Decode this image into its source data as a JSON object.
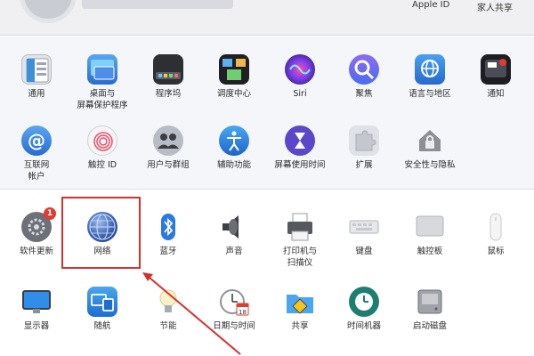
{
  "header": {
    "apple_id": "Apple ID",
    "family_sharing": "家人共享"
  },
  "colors": {
    "highlight": "#d3312c",
    "badge": "#e23b33"
  },
  "top_row1": [
    {
      "label": "通用",
      "icon": "general-icon"
    },
    {
      "label": "桌面与\n屏幕保护程序",
      "icon": "desktop-icon"
    },
    {
      "label": "程序坞",
      "icon": "dock-icon"
    },
    {
      "label": "调度中心",
      "icon": "mission-control-icon"
    },
    {
      "label": "Siri",
      "icon": "siri-icon"
    },
    {
      "label": "聚焦",
      "icon": "spotlight-icon"
    },
    {
      "label": "语言与地区",
      "icon": "language-icon"
    },
    {
      "label": "通知",
      "icon": "notifications-icon"
    }
  ],
  "top_row2": [
    {
      "label": "互联网\n帐户",
      "icon": "internet-accounts-icon"
    },
    {
      "label": "触控 ID",
      "icon": "touch-id-icon"
    },
    {
      "label": "用户与群组",
      "icon": "users-icon"
    },
    {
      "label": "辅助功能",
      "icon": "accessibility-icon"
    },
    {
      "label": "屏幕使用时间",
      "icon": "screen-time-icon"
    },
    {
      "label": "扩展",
      "icon": "extensions-icon"
    },
    {
      "label": "安全性与隐私",
      "icon": "security-icon"
    }
  ],
  "bottom_row1": [
    {
      "label": "软件更新",
      "icon": "software-update-icon",
      "badge": "1"
    },
    {
      "label": "网络",
      "icon": "network-icon"
    },
    {
      "label": "蓝牙",
      "icon": "bluetooth-icon"
    },
    {
      "label": "声音",
      "icon": "sound-icon"
    },
    {
      "label": "打印机与\n扫描仪",
      "icon": "printer-icon"
    },
    {
      "label": "键盘",
      "icon": "keyboard-icon"
    },
    {
      "label": "触控板",
      "icon": "trackpad-icon"
    },
    {
      "label": "鼠标",
      "icon": "mouse-icon"
    }
  ],
  "bottom_row2": [
    {
      "label": "显示器",
      "icon": "displays-icon"
    },
    {
      "label": "随航",
      "icon": "sidecar-icon"
    },
    {
      "label": "节能",
      "icon": "energy-icon"
    },
    {
      "label": "日期与时间",
      "icon": "date-time-icon"
    },
    {
      "label": "共享",
      "icon": "sharing-icon"
    },
    {
      "label": "时间机器",
      "icon": "time-machine-icon"
    },
    {
      "label": "启动磁盘",
      "icon": "startup-disk-icon"
    }
  ],
  "date_icon_day": "18"
}
